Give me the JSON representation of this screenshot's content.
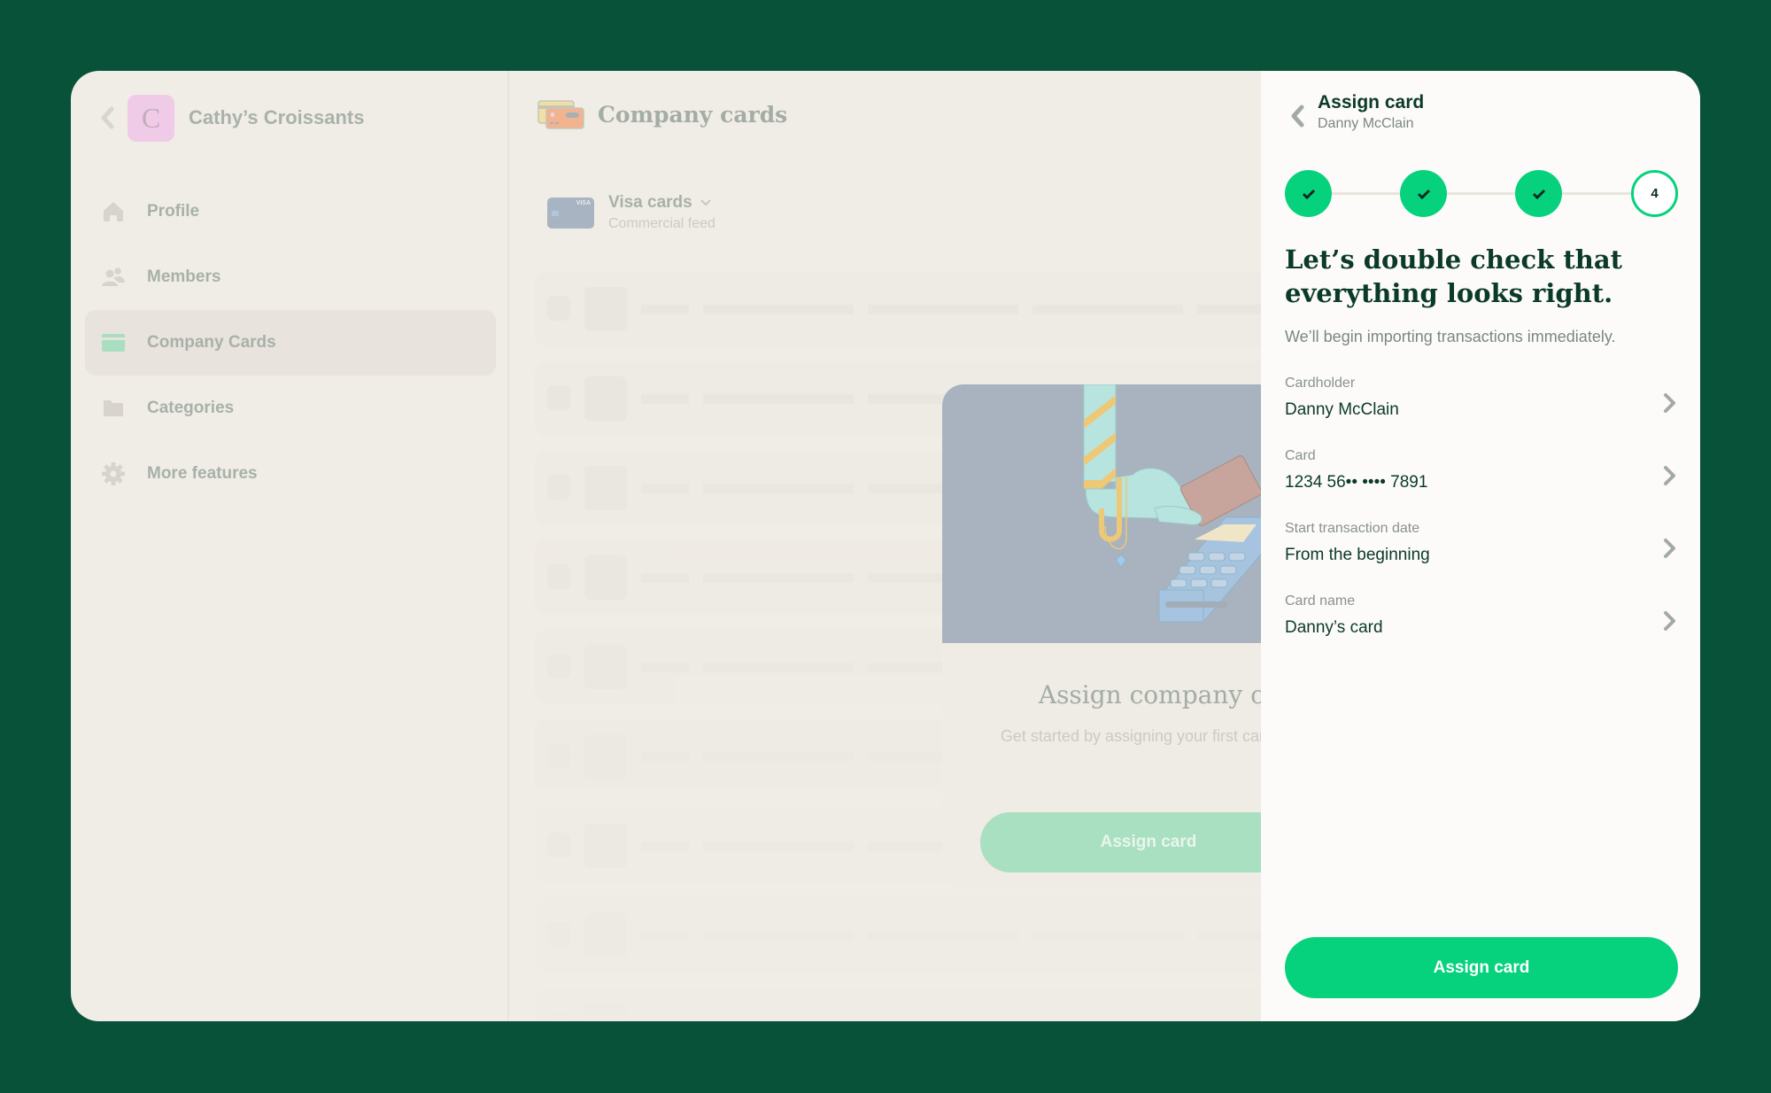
{
  "sidebar": {
    "org_initial": "C",
    "org_name": "Cathy’s Croissants",
    "items": [
      {
        "label": "Profile",
        "icon": "home-icon"
      },
      {
        "label": "Members",
        "icon": "people-icon"
      },
      {
        "label": "Company Cards",
        "icon": "credit-card-icon",
        "active": true
      },
      {
        "label": "Categories",
        "icon": "folder-icon"
      },
      {
        "label": "More features",
        "icon": "gear-icon"
      }
    ]
  },
  "main": {
    "title": "Company cards",
    "feed": {
      "title": "Visa cards",
      "subtitle": "Commercial feed",
      "card_brand": "VISA"
    },
    "empty_state": {
      "title": "Assign company cards",
      "subtitle": "Get started by assigning your first card to a member.",
      "button_label": "Assign card"
    }
  },
  "panel": {
    "title": "Assign card",
    "subtitle": "Danny McClain",
    "stepper": {
      "total": 4,
      "current": 4,
      "current_label": "4"
    },
    "heading": "Let’s double check that everything looks right.",
    "lead": "We’ll begin importing transactions immediately.",
    "fields": [
      {
        "label": "Cardholder",
        "value": "Danny McClain"
      },
      {
        "label": "Card",
        "value": "1234 56•• •••• 7891"
      },
      {
        "label": "Start transaction date",
        "value": "From the beginning"
      },
      {
        "label": "Card name",
        "value": "Danny’s card"
      }
    ],
    "primary_label": "Assign card"
  },
  "colors": {
    "background": "#08523a",
    "accent": "#06d27d",
    "text_dark": "#0b3a2a"
  }
}
